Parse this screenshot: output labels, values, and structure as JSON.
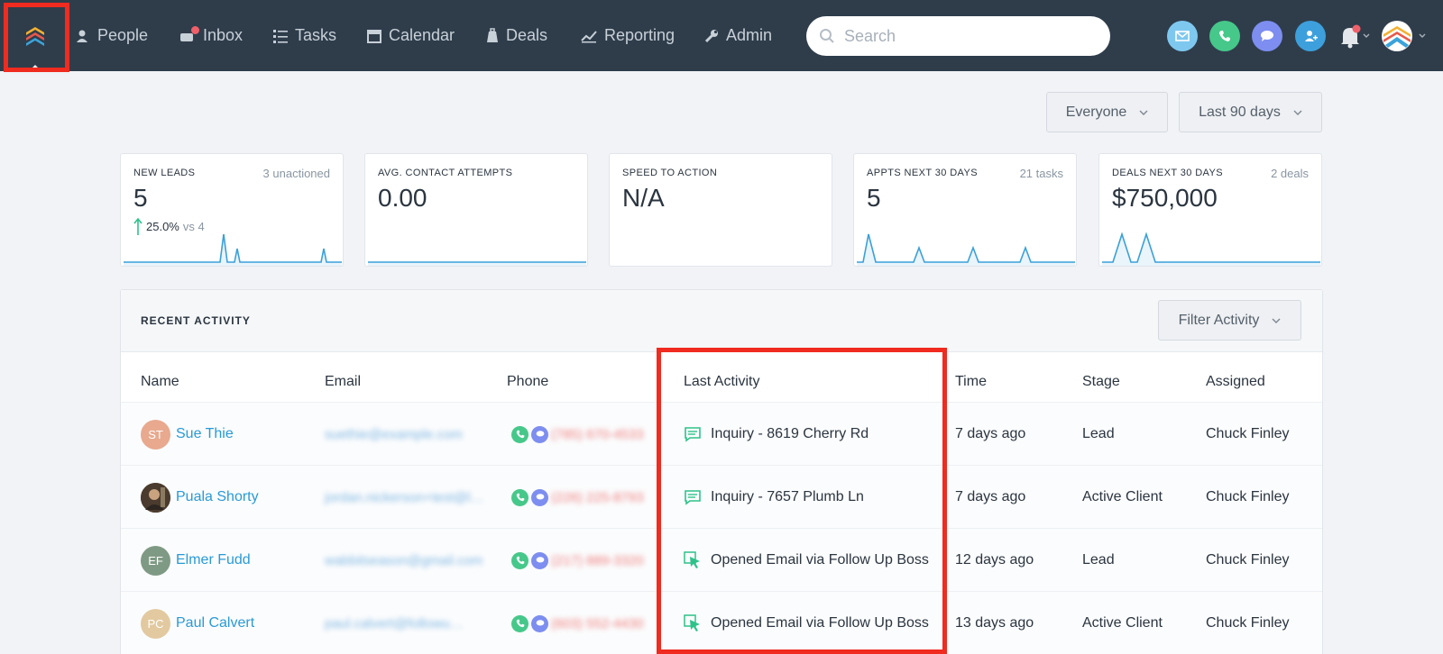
{
  "nav": {
    "items": [
      {
        "label": "People",
        "icon": "person-icon"
      },
      {
        "label": "Inbox",
        "icon": "inbox-icon"
      },
      {
        "label": "Tasks",
        "icon": "tasks-icon"
      },
      {
        "label": "Calendar",
        "icon": "calendar-icon"
      },
      {
        "label": "Deals",
        "icon": "deals-icon"
      },
      {
        "label": "Reporting",
        "icon": "reporting-icon"
      },
      {
        "label": "Admin",
        "icon": "wrench-icon"
      }
    ],
    "search_placeholder": "Search",
    "colors": {
      "bar": "#2f3d4b",
      "notify": "#f0606a"
    }
  },
  "filters": {
    "who": "Everyone",
    "range": "Last 90 days"
  },
  "stats": [
    {
      "label": "NEW LEADS",
      "side": "3 unactioned",
      "value": "5",
      "delta": "25.0%",
      "vs": "vs 4"
    },
    {
      "label": "AVG. CONTACT ATTEMPTS",
      "side": "",
      "value": "0.00"
    },
    {
      "label": "SPEED TO ACTION",
      "side": "",
      "value": "N/A"
    },
    {
      "label": "APPTS NEXT 30 DAYS",
      "side": "21 tasks",
      "value": "5"
    },
    {
      "label": "DEALS NEXT 30 DAYS",
      "side": "2 deals",
      "value": "$750,000"
    }
  ],
  "activity": {
    "title": "RECENT ACTIVITY",
    "filter_label": "Filter Activity",
    "columns": [
      "Name",
      "Email",
      "Phone",
      "Last Activity",
      "Time",
      "Stage",
      "Assigned"
    ],
    "rows": [
      {
        "initials": "ST",
        "avatar_color": "#e8a98f",
        "name": "Sue Thie",
        "email": "suethie@example.com",
        "phone": "(785) 670-4533",
        "activity": "Inquiry - 8619 Cherry Rd",
        "activity_icon": "message-icon",
        "time": "7 days ago",
        "stage": "Lead",
        "assigned": "Chuck Finley"
      },
      {
        "initials": "",
        "avatar_color": "#5a4a3a",
        "name": "Puala Shorty",
        "email": "jordan.nickerson+test@l…",
        "phone": "(226) 225-8793",
        "activity": "Inquiry - 7657 Plumb Ln",
        "activity_icon": "message-icon",
        "time": "7 days ago",
        "stage": "Active Client",
        "assigned": "Chuck Finley"
      },
      {
        "initials": "EF",
        "avatar_color": "#7f9a84",
        "name": "Elmer Fudd",
        "email": "wabbitseason@gmail.com",
        "phone": "(217) 889-3320",
        "activity": "Opened Email via Follow Up Boss",
        "activity_icon": "cursor-icon",
        "time": "12 days ago",
        "stage": "Lead",
        "assigned": "Chuck Finley"
      },
      {
        "initials": "PC",
        "avatar_color": "#e2c9a0",
        "name": "Paul Calvert",
        "email": "paul.calvert@followu…",
        "phone": "(603) 552-4430",
        "activity": "Opened Email via Follow Up Boss",
        "activity_icon": "cursor-icon",
        "time": "13 days ago",
        "stage": "Active Client",
        "assigned": "Chuck Finley"
      }
    ]
  }
}
